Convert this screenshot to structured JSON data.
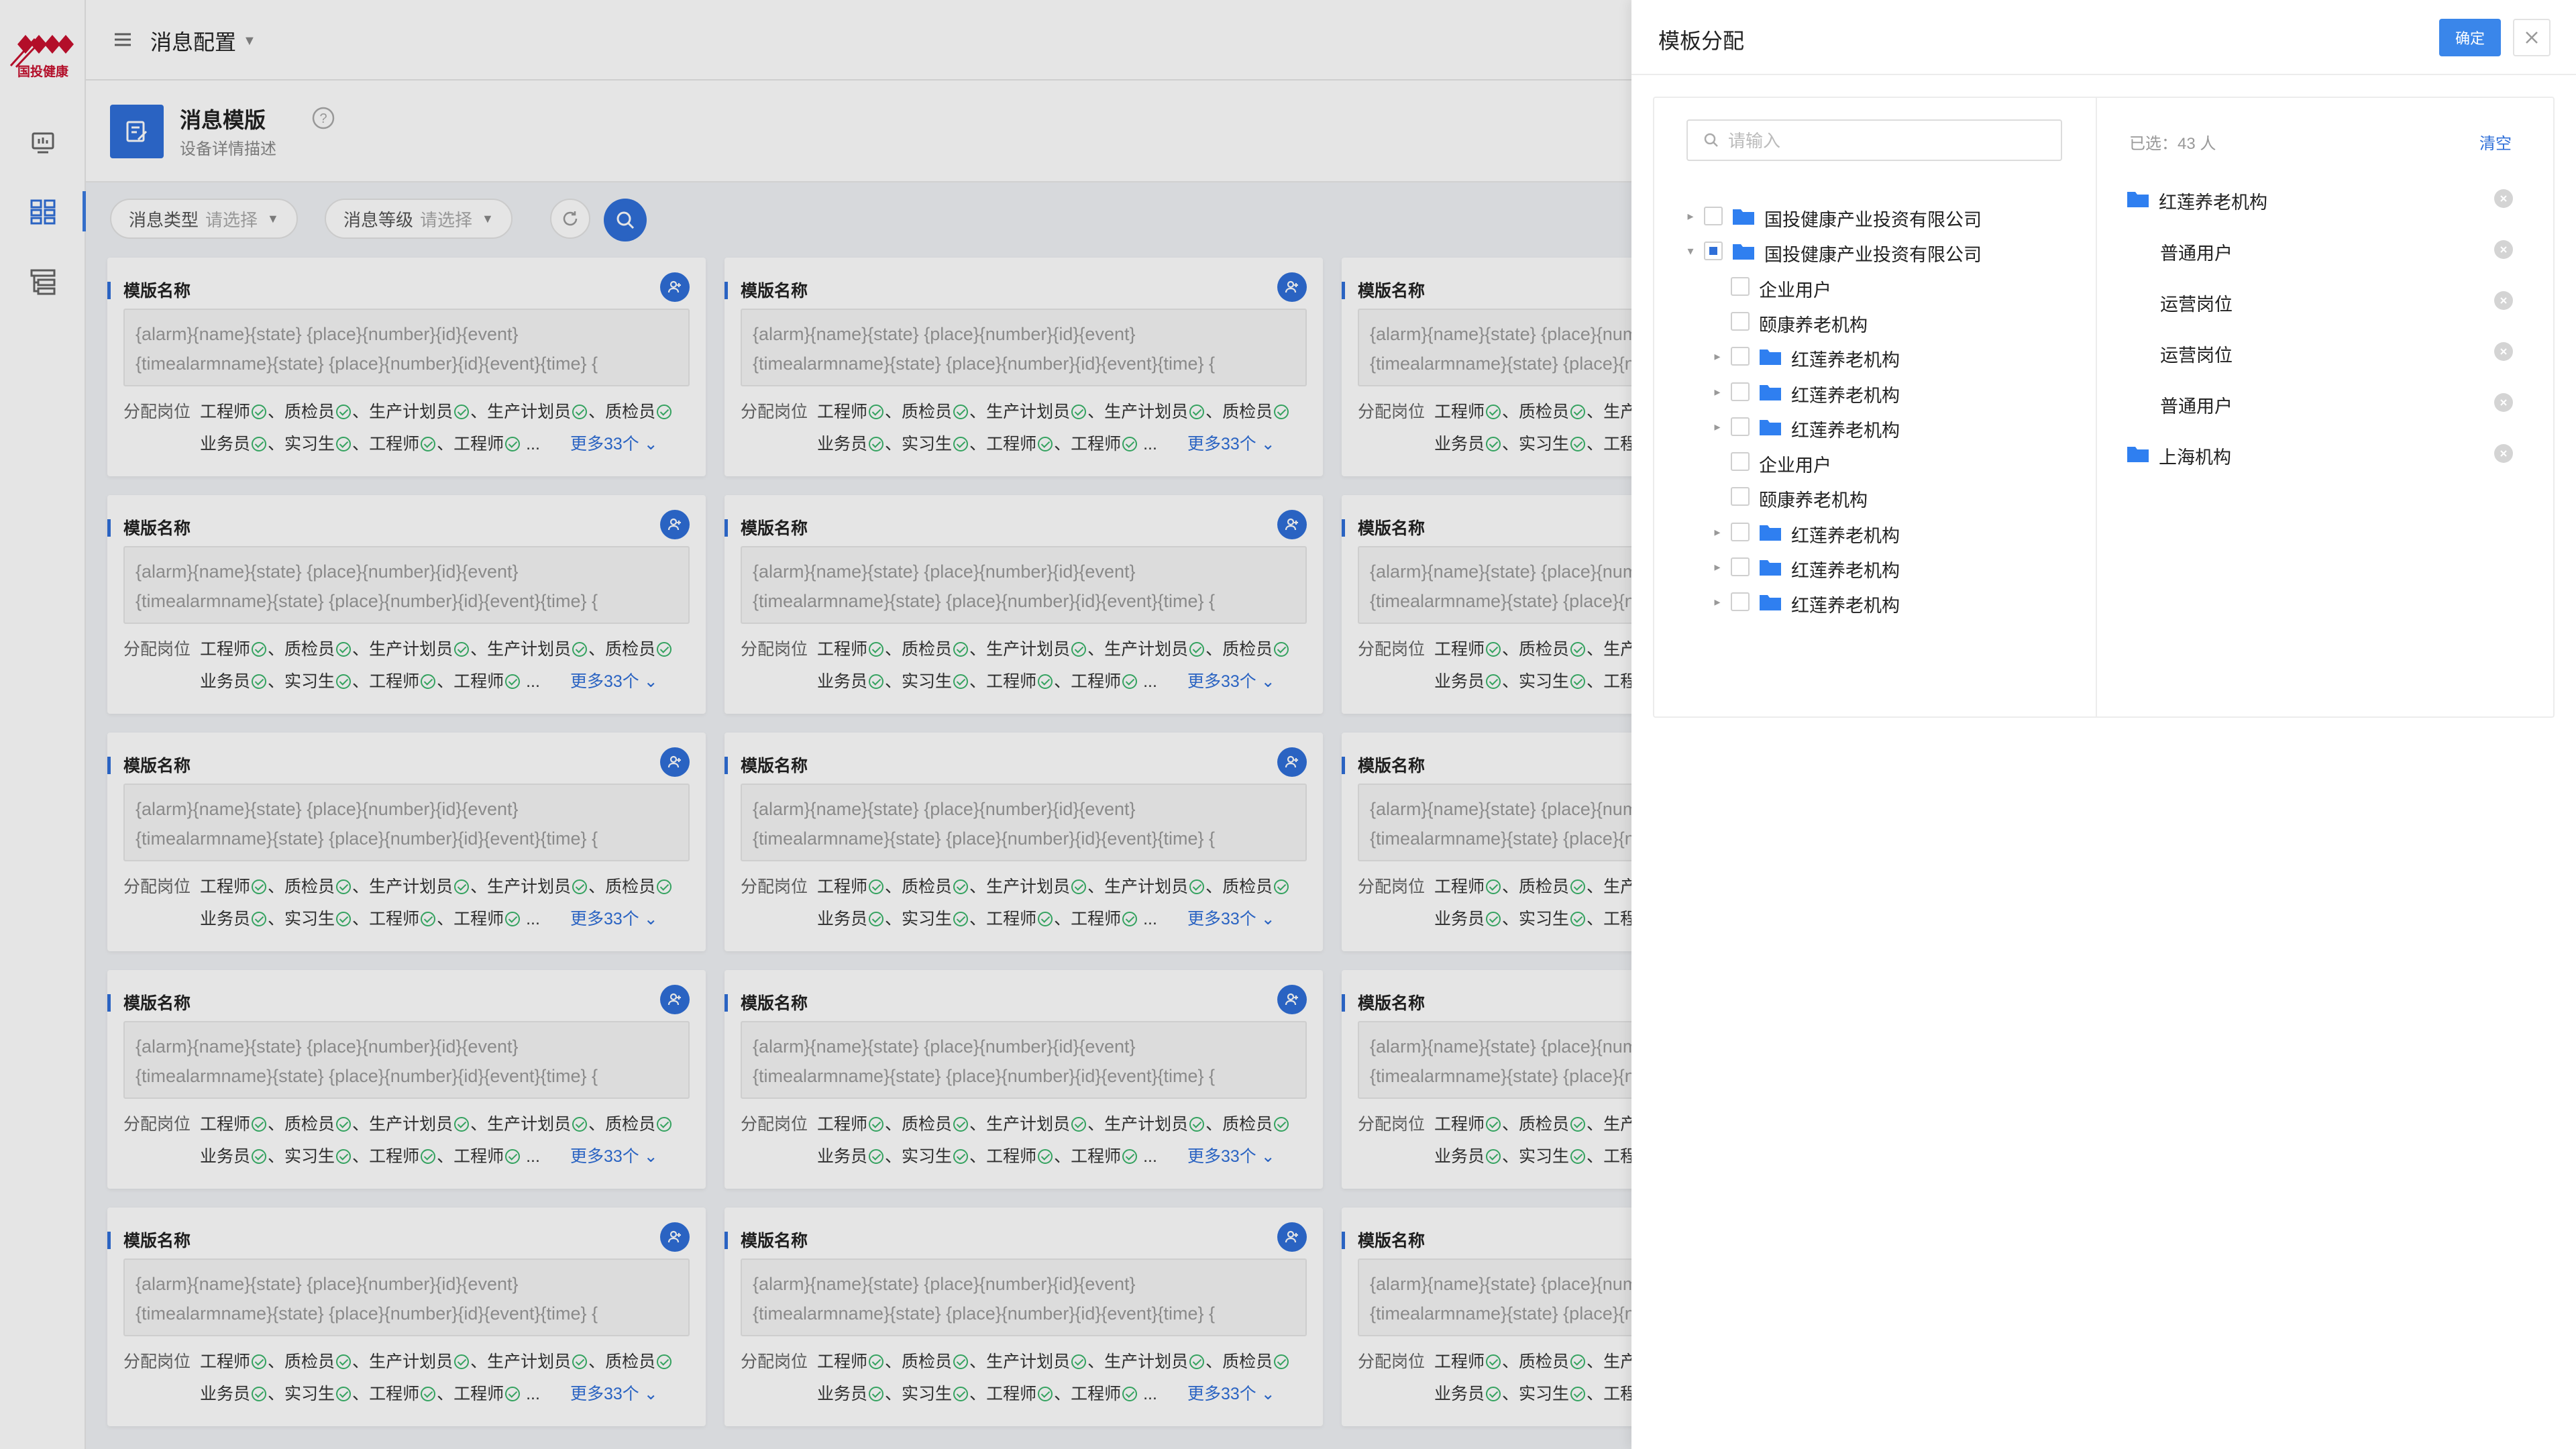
{
  "brand": {
    "logo_text": "国投健康",
    "accent": "#2f6fd8",
    "logo_color": "#c8102e"
  },
  "sidebar": {
    "icons": [
      {
        "name": "monitor-icon"
      },
      {
        "name": "dashboard-grid-icon",
        "active": true
      },
      {
        "name": "tree-list-icon"
      }
    ]
  },
  "topbar": {
    "title": "消息配置"
  },
  "page": {
    "title": "消息模版",
    "subtitle": "设备详情描述"
  },
  "filters": [
    {
      "label": "消息类型",
      "placeholder": "请选择"
    },
    {
      "label": "消息等级",
      "placeholder": "请选择"
    }
  ],
  "card": {
    "title": "模版名称",
    "template_line1": "{alarm}{name}{state} {place}{number}{id}{event}",
    "template_line2": "{timealarmname}{state} {place}{number}{id}{event}{time} {",
    "assign_label": "分配岗位",
    "roles_line1": [
      "工程师",
      "质检员",
      "生产计划员",
      "生产计划员",
      "质检员"
    ],
    "roles_line2": [
      "业务员",
      "实习生",
      "工程师",
      "工程师"
    ],
    "ellipsis": "...",
    "more_text": "更多33个",
    "grid": {
      "rows": 5,
      "cols": 3
    }
  },
  "drawer": {
    "title": "模板分配",
    "confirm_label": "确定",
    "search_placeholder": "请输入",
    "tree": [
      {
        "label": "国投健康产业投资有限公司",
        "level": 0,
        "expand": "collapsed",
        "check": "none",
        "folder": true
      },
      {
        "label": "国投健康产业投资有限公司",
        "level": 0,
        "expand": "expanded",
        "check": "partial",
        "folder": true
      },
      {
        "label": "企业用户",
        "level": 1,
        "expand": "none",
        "check": "none",
        "folder": false
      },
      {
        "label": "颐康养老机构",
        "level": 1,
        "expand": "none",
        "check": "none",
        "folder": false
      },
      {
        "label": "红莲养老机构",
        "level": 1,
        "expand": "collapsed",
        "check": "none",
        "folder": true
      },
      {
        "label": "红莲养老机构",
        "level": 1,
        "expand": "collapsed",
        "check": "none",
        "folder": true
      },
      {
        "label": "红莲养老机构",
        "level": 1,
        "expand": "collapsed",
        "check": "none",
        "folder": true
      },
      {
        "label": "企业用户",
        "level": 1,
        "expand": "none",
        "check": "none",
        "folder": false
      },
      {
        "label": "颐康养老机构",
        "level": 1,
        "expand": "none",
        "check": "none",
        "folder": false
      },
      {
        "label": "红莲养老机构",
        "level": 1,
        "expand": "collapsed",
        "check": "none",
        "folder": true
      },
      {
        "label": "红莲养老机构",
        "level": 1,
        "expand": "collapsed",
        "check": "none",
        "folder": true
      },
      {
        "label": "红莲养老机构",
        "level": 1,
        "expand": "collapsed",
        "check": "none",
        "folder": true
      }
    ],
    "selected_count": "已选：43 人",
    "clear_label": "清空",
    "selected": [
      {
        "label": "红莲养老机构",
        "folder": true
      },
      {
        "label": "普通用户",
        "folder": false
      },
      {
        "label": "运营岗位",
        "folder": false
      },
      {
        "label": "运营岗位",
        "folder": false
      },
      {
        "label": "普通用户",
        "folder": false
      },
      {
        "label": "上海机构",
        "folder": true
      }
    ]
  }
}
